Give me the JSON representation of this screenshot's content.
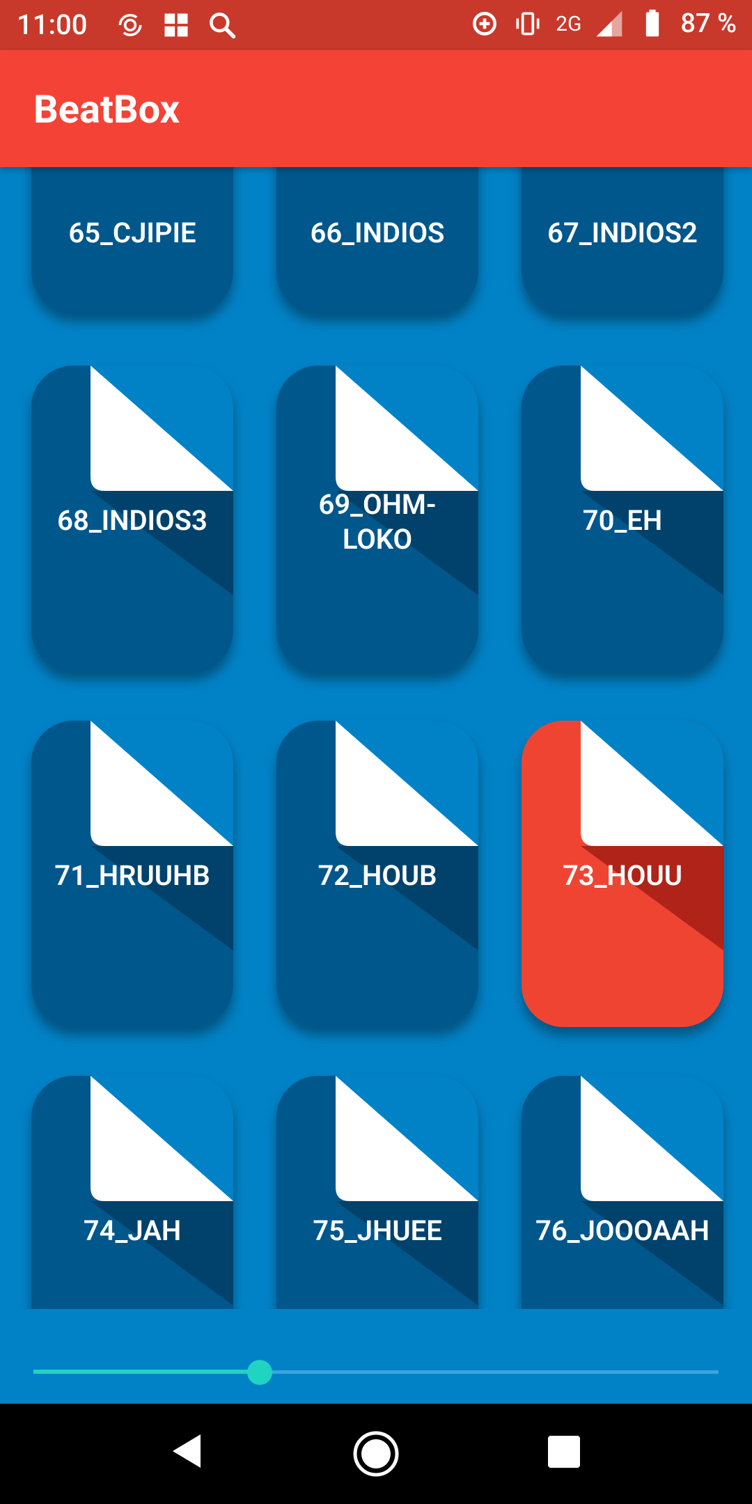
{
  "status_bar": {
    "time": "11:00",
    "network": "2G",
    "battery": "87 %"
  },
  "app_bar": {
    "title": "BeatBox"
  },
  "sounds": [
    {
      "label": "65_CJIPIE"
    },
    {
      "label": "66_INDIOS"
    },
    {
      "label": "67_INDIOS2"
    },
    {
      "label": "68_INDIOS3"
    },
    {
      "label": "69_OHM-LOKO"
    },
    {
      "label": "70_EH"
    },
    {
      "label": "71_HRUUHB"
    },
    {
      "label": "72_HOUB"
    },
    {
      "label": "73_HOUU",
      "active": true
    },
    {
      "label": "74_JAH"
    },
    {
      "label": "75_JHUEE"
    },
    {
      "label": "76_JOOOAAH"
    }
  ],
  "playback_slider": {
    "value": 0.33
  },
  "colors": {
    "status_bar": "#c8392b",
    "app_bar": "#f44336",
    "background": "#0282c6",
    "card": "#00578c",
    "card_active": "#f04433",
    "slider_accent": "#20d3c2"
  },
  "nav_bar": {
    "icons": [
      "back-icon",
      "home-icon",
      "recents-icon"
    ]
  }
}
